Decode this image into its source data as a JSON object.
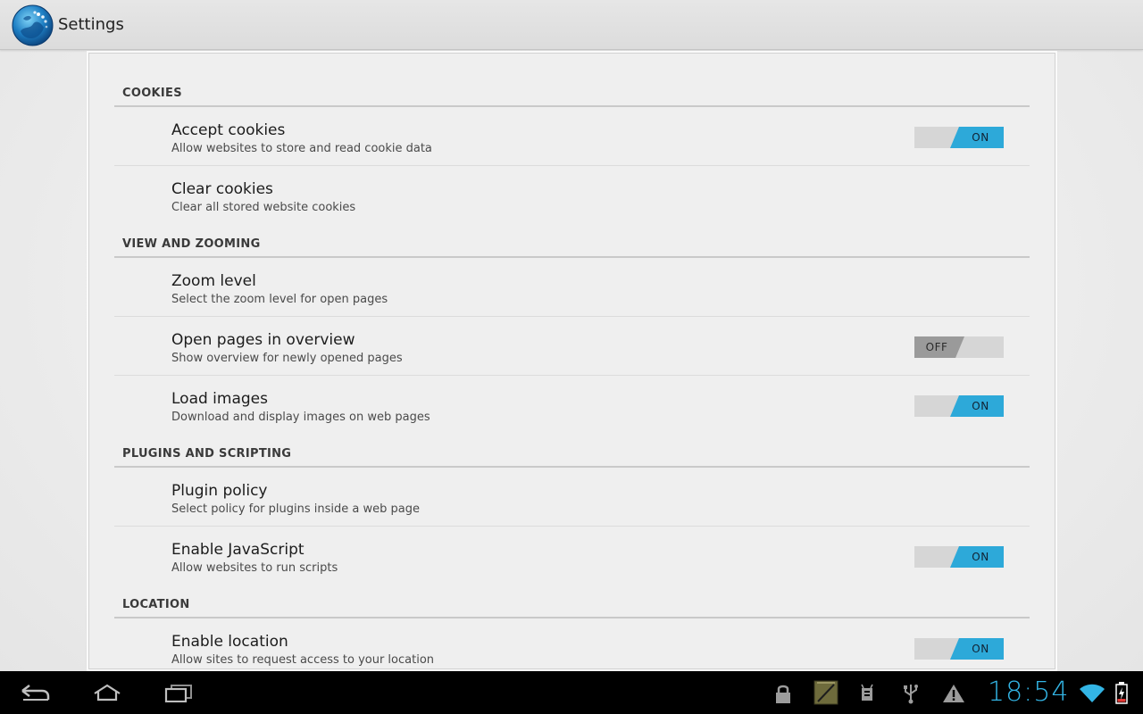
{
  "actionbar": {
    "title": "Settings",
    "app_icon": "globe-icon"
  },
  "sections": [
    {
      "label": "COOKIES",
      "items": [
        {
          "title": "Accept cookies",
          "summary": "Allow websites to store and read cookie data",
          "toggle": "ON"
        },
        {
          "title": "Clear cookies",
          "summary": "Clear all stored website cookies",
          "toggle": null
        }
      ]
    },
    {
      "label": "VIEW AND ZOOMING",
      "items": [
        {
          "title": "Zoom level",
          "summary": "Select the zoom level for open pages",
          "toggle": null
        },
        {
          "title": "Open pages in overview",
          "summary": "Show overview for newly opened pages",
          "toggle": "OFF"
        },
        {
          "title": "Load images",
          "summary": "Download and display images on web pages",
          "toggle": "ON"
        }
      ]
    },
    {
      "label": "PLUGINS AND SCRIPTING",
      "items": [
        {
          "title": "Plugin policy",
          "summary": "Select policy for plugins inside a web page",
          "toggle": null
        },
        {
          "title": "Enable JavaScript",
          "summary": "Allow websites to run scripts",
          "toggle": "ON"
        }
      ]
    },
    {
      "label": "LOCATION",
      "items": [
        {
          "title": "Enable location",
          "summary": "Allow sites to request access to your location",
          "toggle": "ON"
        }
      ]
    }
  ],
  "navbar": {
    "buttons": [
      "back-icon",
      "home-icon",
      "recent-apps-icon"
    ],
    "status_icons": [
      "lock-icon",
      "notes-icon",
      "android-debug-icon",
      "usb-icon",
      "warning-icon"
    ],
    "clock": "18:54",
    "wifi": "wifi-icon",
    "battery": "battery-charging-icon"
  },
  "colors": {
    "accent": "#33b5e5",
    "switch_on": "#2da9d9",
    "switch_off": "#9a9a9a"
  }
}
